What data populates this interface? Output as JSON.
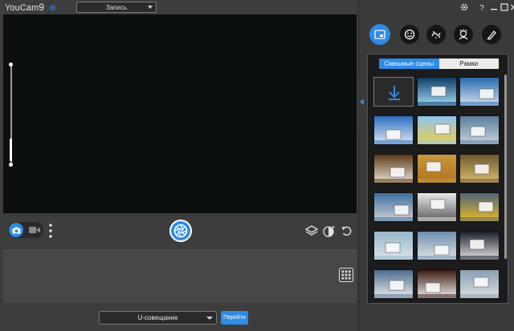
{
  "app": {
    "title": "YouCam",
    "version": "9"
  },
  "header": {
    "mode_select": "Запись"
  },
  "effects": {
    "tabs": [
      "scenes-icon",
      "emoji-icon",
      "particles-icon",
      "avatar-icon",
      "brush-icon"
    ],
    "active_tab": 0,
    "segments": [
      "Смешные сцены",
      "Рамки"
    ],
    "active_segment": 0,
    "items": [
      {
        "name": "download-more",
        "colors": [
          "#2b2b2b",
          "#2e8be6"
        ]
      },
      {
        "name": "spotlight-stage",
        "colors": [
          "#0e3d66",
          "#a8e4ff"
        ]
      },
      {
        "name": "billboard-sky",
        "colors": [
          "#2a6cb0",
          "#dfe7ef"
        ]
      },
      {
        "name": "balloon-sky-1",
        "colors": [
          "#2d6fc0",
          "#e9eef3"
        ]
      },
      {
        "name": "hot-air-balloons",
        "colors": [
          "#8fc4f0",
          "#f0d040"
        ]
      },
      {
        "name": "city-billboard",
        "colors": [
          "#5a7d9e",
          "#cfd8e0"
        ]
      },
      {
        "name": "gallery-frame-1",
        "colors": [
          "#5b3a1a",
          "#f3ead8"
        ]
      },
      {
        "name": "gallery-frame-2",
        "colors": [
          "#c89a3c",
          "#b07020"
        ]
      },
      {
        "name": "autumn-frame",
        "colors": [
          "#6e5a2e",
          "#e0c070"
        ]
      },
      {
        "name": "stadium-screen",
        "colors": [
          "#3c6fa0",
          "#d8d8d8"
        ]
      },
      {
        "name": "newspaper",
        "colors": [
          "#e9e9e9",
          "#555555"
        ]
      },
      {
        "name": "times-square",
        "colors": [
          "#50647a",
          "#f0c020"
        ]
      },
      {
        "name": "window-cleaners",
        "colors": [
          "#97b8cc",
          "#dfe6ea"
        ]
      },
      {
        "name": "crowd-signs",
        "colors": [
          "#6d8fb0",
          "#e8e8e8"
        ]
      },
      {
        "name": "night-billboards",
        "colors": [
          "#1a1e2a",
          "#eeeeee"
        ]
      },
      {
        "name": "building-screen",
        "colors": [
          "#4b6d8e",
          "#f2f2f2"
        ]
      },
      {
        "name": "theater-screen",
        "colors": [
          "#3a1c10",
          "#fafafa"
        ]
      },
      {
        "name": "skyscraper-screens",
        "colors": [
          "#8aa0b4",
          "#e0e0e0"
        ]
      }
    ]
  },
  "bottom": {
    "meeting_select": "U-совещание",
    "go_button": "Перейти"
  },
  "colors": {
    "accent": "#2e8be6",
    "panel": "#3a3a3a",
    "viewport": "#0b0f0d"
  }
}
